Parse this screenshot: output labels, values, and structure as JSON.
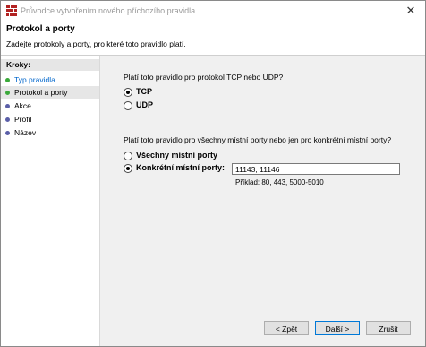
{
  "window": {
    "title": "Průvodce vytvořením nového příchozího pravidla",
    "close_glyph": "✕"
  },
  "header": {
    "title": "Protokol a porty",
    "subtitle": "Zadejte protokoly a porty, pro které toto pravidlo platí."
  },
  "sidebar": {
    "heading": "Kroky:",
    "steps": [
      {
        "label": "Typ pravidla",
        "state": "done"
      },
      {
        "label": "Protokol a porty",
        "state": "current"
      },
      {
        "label": "Akce",
        "state": "pending"
      },
      {
        "label": "Profil",
        "state": "pending"
      },
      {
        "label": "Název",
        "state": "pending"
      }
    ]
  },
  "protocol": {
    "question": "Platí toto pravidlo pro protokol TCP nebo UDP?",
    "options": [
      {
        "label": "TCP",
        "checked": true
      },
      {
        "label": "UDP",
        "checked": false
      }
    ]
  },
  "ports": {
    "question": "Platí toto pravidlo pro všechny místní porty nebo jen pro konkrétní místní porty?",
    "options": [
      {
        "label": "Všechny místní porty",
        "checked": false
      },
      {
        "label": "Konkrétní místní porty:",
        "checked": true
      }
    ],
    "value": "11143, 11146",
    "example": "Příklad: 80, 443, 5000-5010"
  },
  "buttons": {
    "back": "< Zpět",
    "next": "Další >",
    "cancel": "Zrušit"
  },
  "colors": {
    "done_dot": "#3aa93a",
    "pending_dot": "#5b5fa8",
    "link": "#0066cc",
    "content_bg": "#f0f0f0"
  }
}
